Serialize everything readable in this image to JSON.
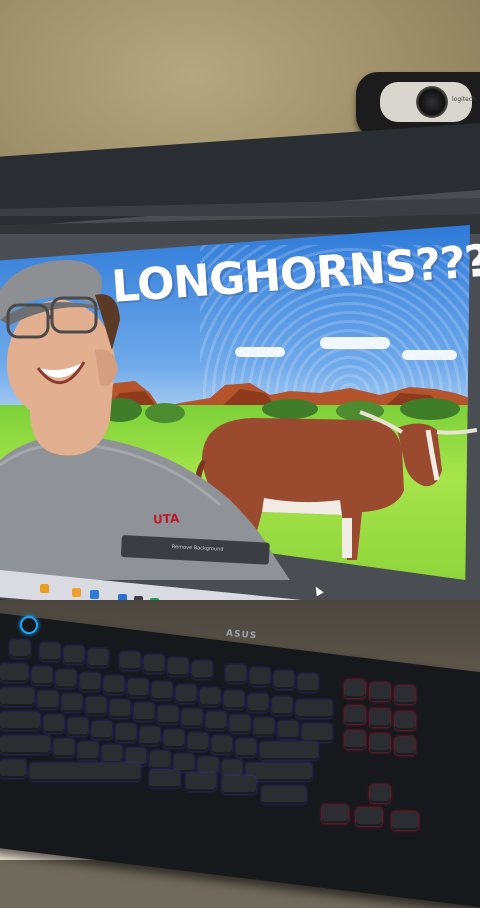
{
  "scene": {
    "description_labels": {
      "thumbnail_title": "LONGHORNS???",
      "shirt_logo": "UTA",
      "monitor_brand": "ASUS",
      "webcam_brand": "logitech",
      "photoshop_status": "Remove Background"
    }
  },
  "colors": {
    "wall": "#9c8e68",
    "sky": "#2e7ad8",
    "grass": "#8fd33c",
    "keyboard_glow": "#5a3cdc",
    "accent_red": "#e62846"
  }
}
